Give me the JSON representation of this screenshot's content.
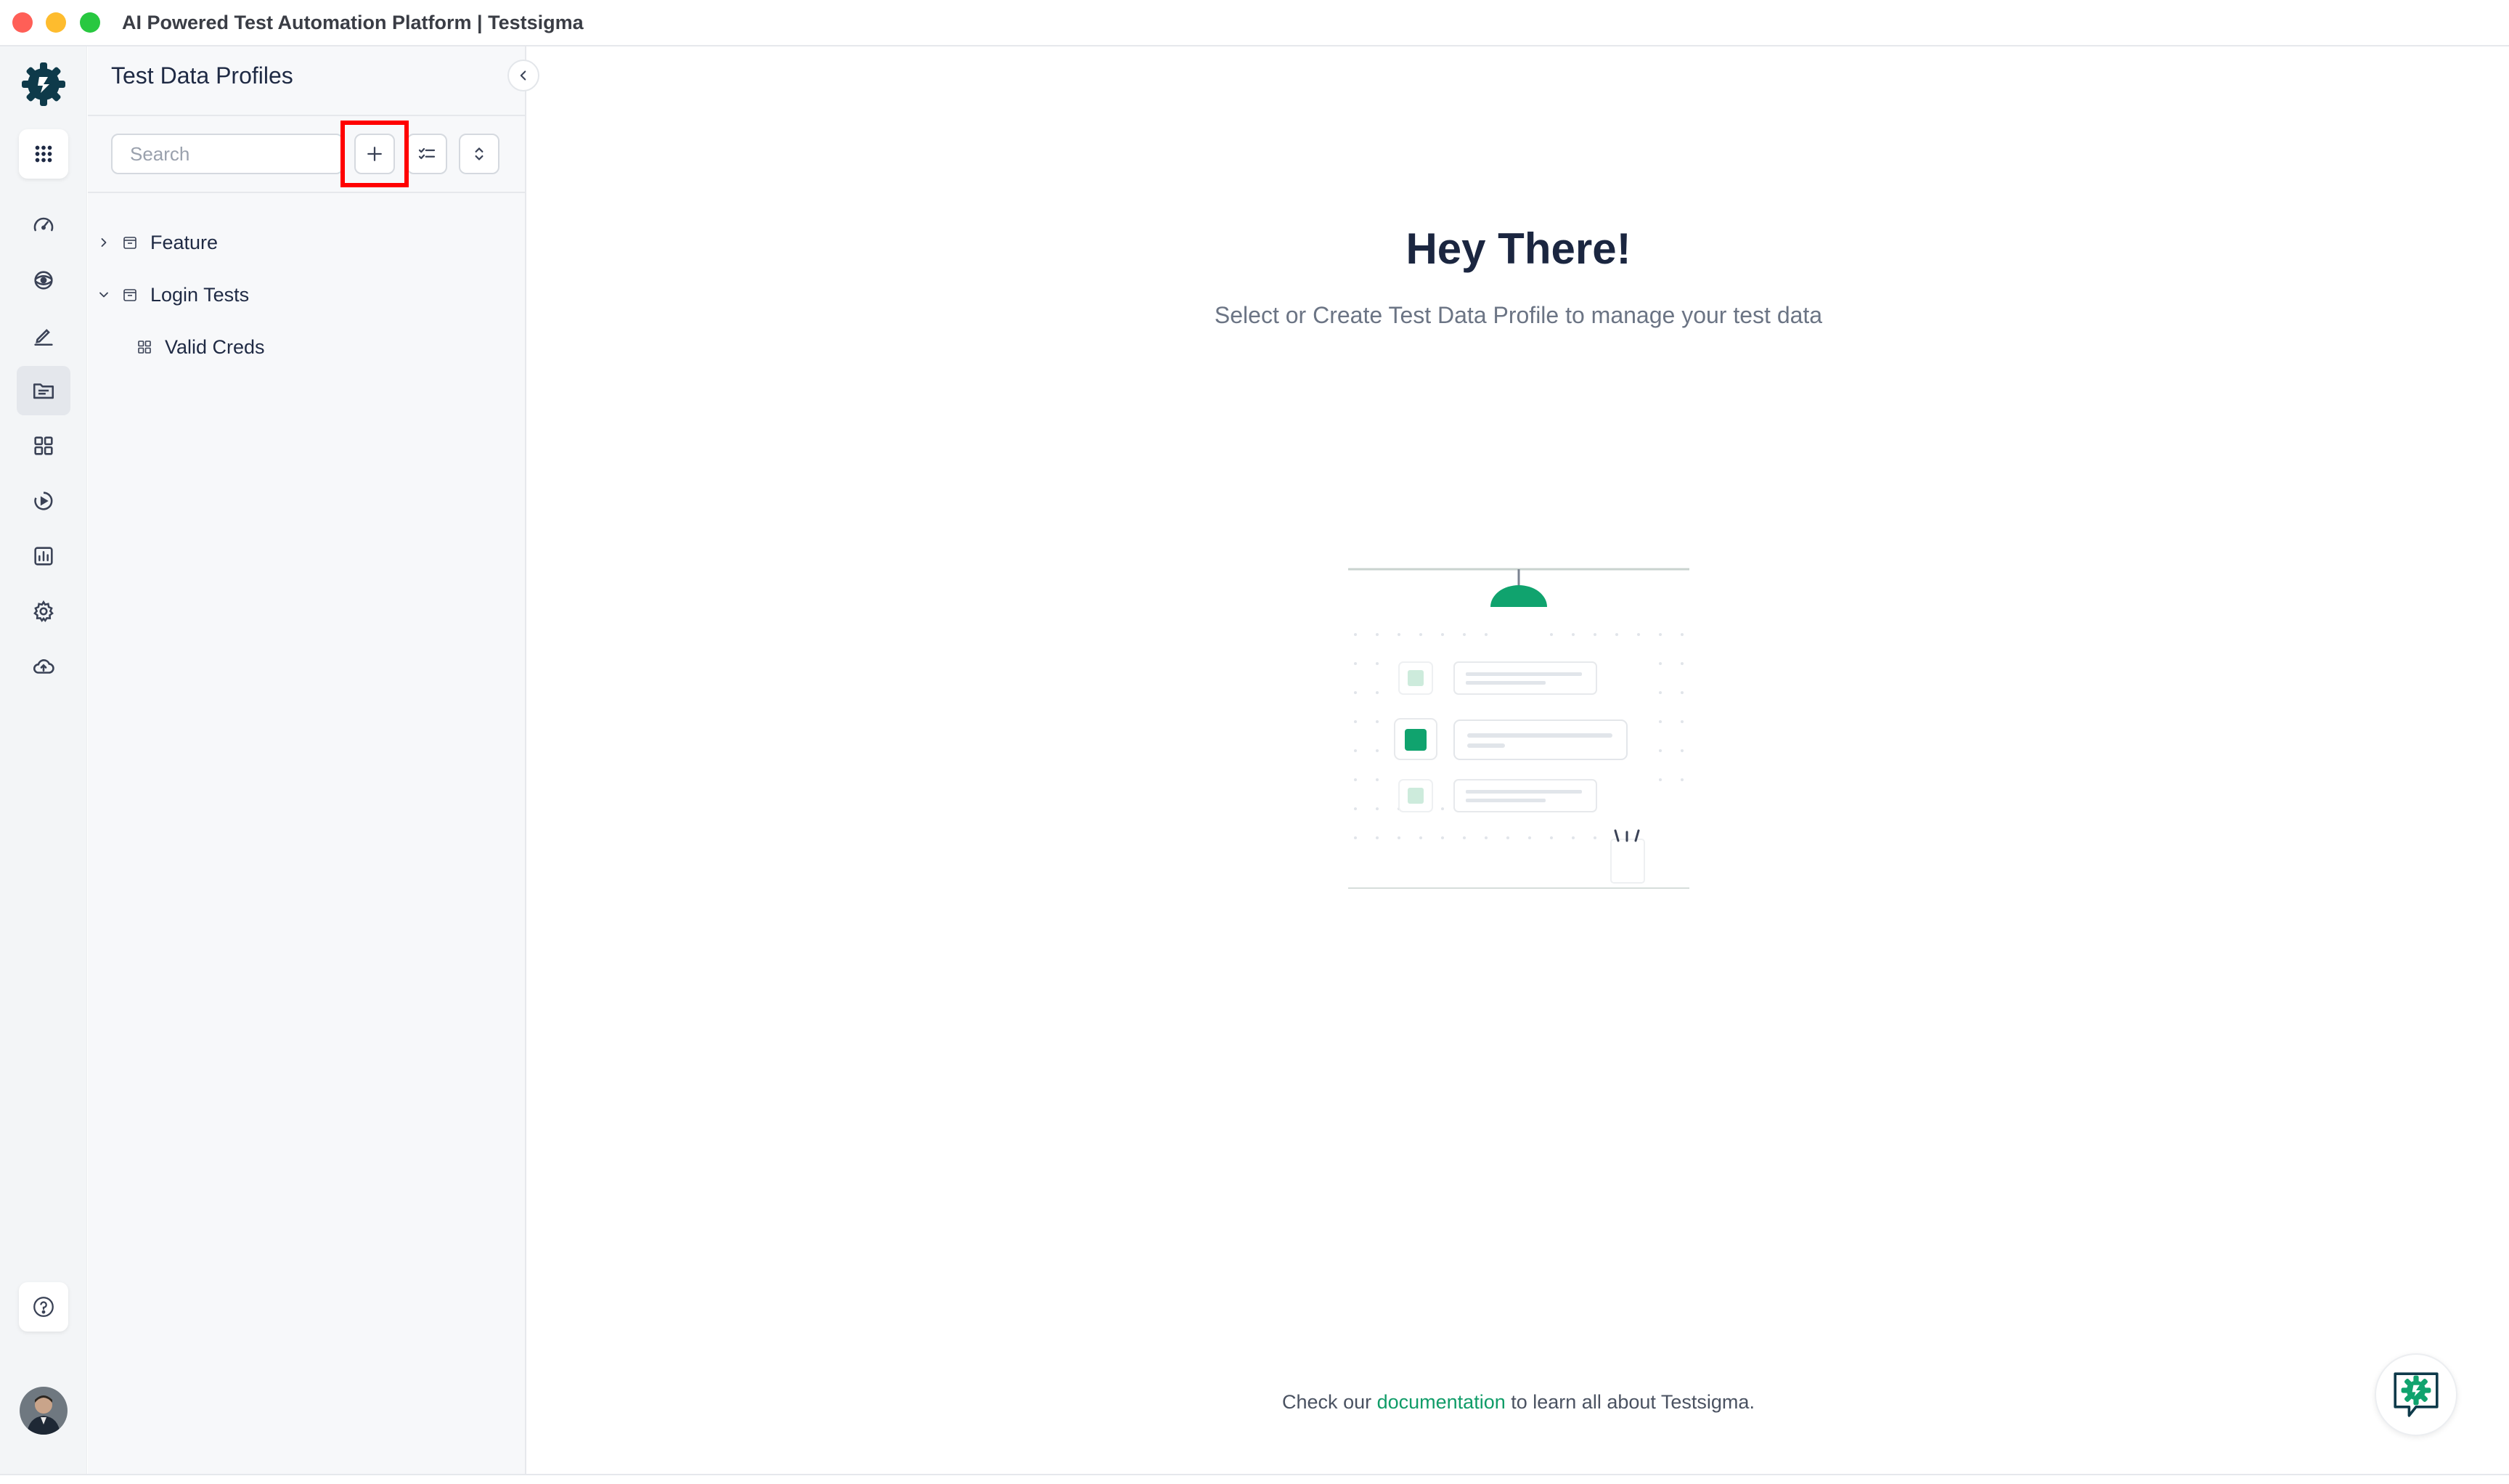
{
  "window": {
    "title": "AI Powered Test Automation Platform | Testsigma"
  },
  "rail": {
    "items": [
      {
        "name": "dashboard-icon"
      },
      {
        "name": "visibility-icon"
      },
      {
        "name": "edit-icon"
      },
      {
        "name": "test-data-icon",
        "active": true
      },
      {
        "name": "grid-icon"
      },
      {
        "name": "run-icon"
      },
      {
        "name": "reports-icon"
      },
      {
        "name": "settings-icon"
      },
      {
        "name": "cloud-upload-icon"
      }
    ]
  },
  "panel": {
    "title": "Test Data Profiles",
    "search_placeholder": "Search",
    "tree": [
      {
        "label": "Feature",
        "expanded": false
      },
      {
        "label": "Login Tests",
        "expanded": true,
        "children": [
          {
            "label": "Valid Creds"
          }
        ]
      }
    ]
  },
  "main": {
    "heading": "Hey There!",
    "subheading": "Select or Create Test Data Profile to manage your test data",
    "footer_prefix": "Check our",
    "footer_link": "documentation",
    "footer_suffix": "to learn all about Testsigma."
  },
  "colors": {
    "brand_green": "#109c68",
    "brand_dark": "#0e3a4a",
    "highlight_red": "#ff0000"
  }
}
